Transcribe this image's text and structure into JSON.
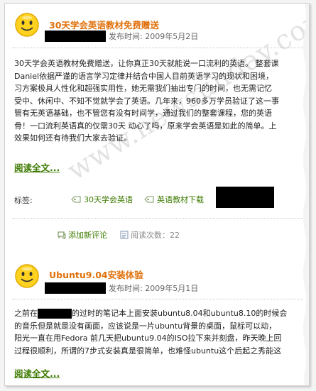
{
  "posts": [
    {
      "title": "30天学会英语教材免费赠送",
      "meta_label": "发布时间: 2009年5月2日",
      "body_lines": [
        "30天学会英语教材免费赠送，让你真正30天就能说一口流利的英语。 整套课",
        "Daniel依据严谨的语言学习定律并结合中国人目前英语学习的现状和困境，",
        "习方案极具人性化和超强实用性，她无需我们抽出专门的时间，也无需记忆",
        "受中、休闲中、不知不觉就学会了英语。几年来，960多万学员验证了这一事",
        "管有无英语基础，也不管您有没有时间学，通过我们的整套课程，您的英语",
        "骨！一口流利英语真的仅需30天 动心了吗，原来学会英语是如此的简单。上",
        "效果如何还有待我们大家去验证。"
      ],
      "read_more": "阅读全文...",
      "tags_label": "标签:",
      "tags": [
        "30天学会英语",
        "英语教材下载"
      ],
      "add_comment": "添加新评论",
      "read_count": "阅读次数：22"
    },
    {
      "title": "Ubuntu9.04安装体验",
      "meta_label": "发布时间: 2009年5月1日",
      "line1_before": "之前在",
      "line1_after": "的过时的笔记本上面安装ubuntu8.04和ubuntu8.10的时候会",
      "body_lines": [
        "的音乐但是就是没有画面，应该说是一片ubuntu背景的桌面，鼠标可以动，",
        "阳光一直在用Fedora 前几天把ubuntu9.04的ISO拉下来并刻盘，昨天晚上回",
        "过程很顺利，所谓的7步式安装真是很简单，也难怪ubuntu这个后起之秀能这"
      ],
      "read_more": "阅读全文..."
    }
  ],
  "watermark": "www.newsunday.com",
  "colors": {
    "title": "#e0700a",
    "link": "#3d7a00",
    "meta": "#666666"
  }
}
